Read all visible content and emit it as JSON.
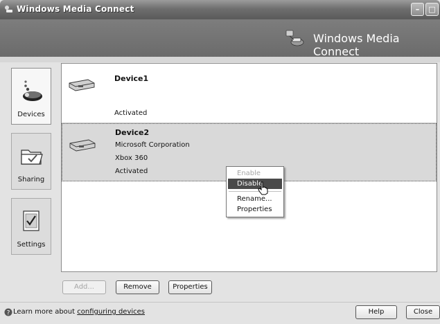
{
  "window": {
    "title": "Windows Media Connect"
  },
  "header": {
    "title": "Windows Media Connect"
  },
  "nav": {
    "devices": "Devices",
    "sharing": "Sharing",
    "settings": "Settings"
  },
  "devices": [
    {
      "name": "Device1",
      "manufacturer": "",
      "model": "",
      "status": "Activated"
    },
    {
      "name": "Device2",
      "manufacturer": "Microsoft Corporation",
      "model": "Xbox 360",
      "status": "Activated"
    }
  ],
  "context_menu": {
    "items": [
      {
        "label": "Enable",
        "state": "disabled"
      },
      {
        "label": "Disable",
        "state": "highlighted"
      },
      {
        "label": "Rename...",
        "state": "normal"
      },
      {
        "label": "Properties",
        "state": "normal"
      }
    ]
  },
  "actions": {
    "add": "Add...",
    "remove": "Remove",
    "properties": "Properties"
  },
  "status": {
    "text_prefix": "Learn more about ",
    "link": "configuring devices"
  },
  "dialog": {
    "help": "Help",
    "close": "Close"
  },
  "colors": {
    "header": "#6e6e6e",
    "selection": "#d9d9d9",
    "menu_highlight": "#4a4a4a"
  }
}
